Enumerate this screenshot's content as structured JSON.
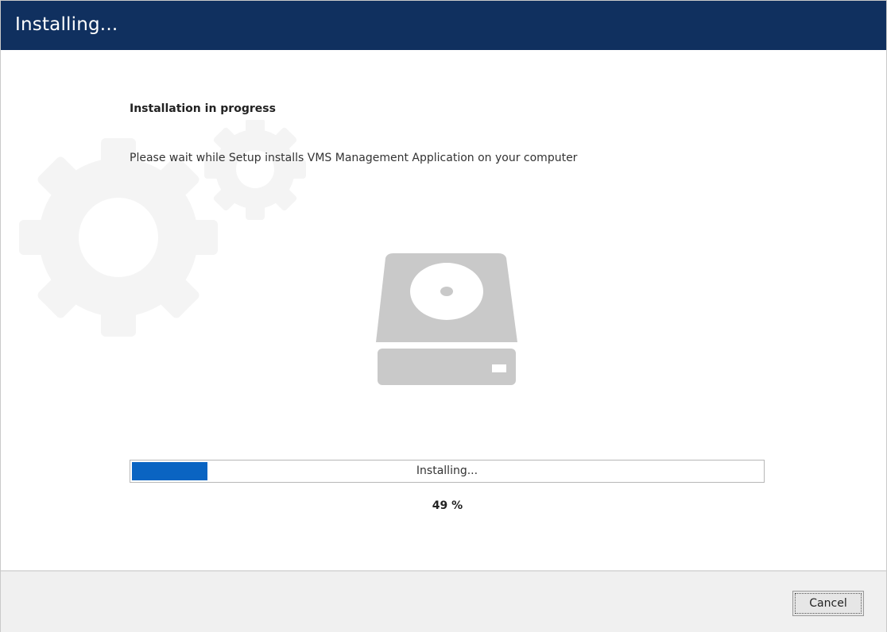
{
  "window": {
    "title": "Installing..."
  },
  "main": {
    "heading": "Installation in progress",
    "description": "Please wait while Setup installs VMS Management Application on your computer",
    "illustration_icon": "hard-drive-icon",
    "background_icon": "gears-icon"
  },
  "progress": {
    "value_percent": 49,
    "bar_fill_fraction": 0.12,
    "status_label": "Installing...",
    "percent_label": "49 %"
  },
  "footer": {
    "cancel_label": "Cancel"
  },
  "colors": {
    "titlebar": "#10305f",
    "progress_fill": "#0a64c2",
    "footer": "#f0f0f0"
  }
}
